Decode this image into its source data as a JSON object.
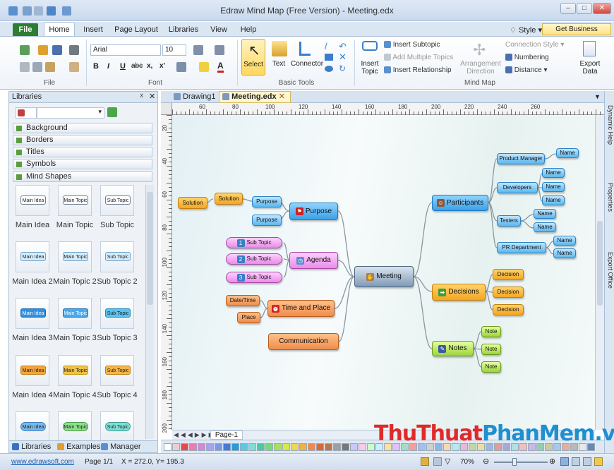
{
  "window": {
    "title": "Edraw Mind Map (Free Version) - Meeting.edx"
  },
  "ribbon": {
    "tabs": [
      "File",
      "Home",
      "Insert",
      "Page Layout",
      "Libraries",
      "View",
      "Help"
    ],
    "style_label": "Style",
    "business_label": "Get Business Version...",
    "font_name": "Arial",
    "font_size": "10",
    "group_labels": {
      "file": "File",
      "font": "Font",
      "basic_tools": "Basic Tools",
      "mind_map": "Mind Map"
    },
    "select_label": "Select",
    "text_label": "Text",
    "connector_label": "Connector",
    "insert_topic_label": "Insert\nTopic",
    "insert_subtopic_label": "Insert Subtopic",
    "add_multiple_label": "Add Multiple Topics",
    "insert_relationship_label": "Insert Relationship",
    "arrangement_label": "Arrangement\nDirection",
    "connection_style_label": "Connection Style",
    "numbering_label": "Numbering",
    "distance_label": "Distance",
    "export_label": "Export\nData"
  },
  "libraries": {
    "title": "Libraries",
    "categories": [
      "Background",
      "Borders",
      "Titles",
      "Symbols",
      "Mind Shapes"
    ],
    "shapes": [
      {
        "shape_text": "Main Idea",
        "label": "Main Idea",
        "fill": "#ffffff",
        "stroke": "#6f7f90"
      },
      {
        "shape_text": "Main Topic",
        "label": "Main Topic",
        "fill": "#ffffff",
        "stroke": "#6f7f90"
      },
      {
        "shape_text": "Sub Topic",
        "label": "Sub Topic",
        "fill": "#ffffff",
        "stroke": "#6f7f90"
      },
      {
        "shape_text": "Main Idea",
        "label": "Main Idea 2",
        "fill": "#d6eefc",
        "stroke": "#6f9fc6"
      },
      {
        "shape_text": "Main Topic",
        "label": "Main Topic 2",
        "fill": "#d6eefc",
        "stroke": "#6f9fc6"
      },
      {
        "shape_text": "Sub Topic",
        "label": "Sub Topic 2",
        "fill": "#d6eefc",
        "stroke": "#6f9fc6"
      },
      {
        "shape_text": "Main Idea",
        "label": "Main Idea 3",
        "fill": "#2f8fe0",
        "stroke": "#1f6db0"
      },
      {
        "shape_text": "Main Topic",
        "label": "Main Topic 3",
        "fill": "#4aa8ec",
        "stroke": "#1f6db0"
      },
      {
        "shape_text": "Sub Topic",
        "label": "Sub Topic 3",
        "fill": "#5ac4f0",
        "stroke": "#1f8ab0"
      },
      {
        "shape_text": "Main Idea",
        "label": "Main Idea 4",
        "fill": "#f5a43c",
        "stroke": "#c47f0e"
      },
      {
        "shape_text": "Main Topic",
        "label": "Main Topic 4",
        "fill": "#f1c24a",
        "stroke": "#c49a0e"
      },
      {
        "shape_text": "Sub Topic",
        "label": "Sub Topic 4",
        "fill": "#f5b64a",
        "stroke": "#c47f0e"
      },
      {
        "shape_text": "Main Idea",
        "label": "",
        "fill": "#7ab8ef",
        "stroke": "#3c7fc0"
      },
      {
        "shape_text": "Main Topic",
        "label": "",
        "fill": "#8ee28e",
        "stroke": "#4a9a4a"
      },
      {
        "shape_text": "Sub Topic",
        "label": "",
        "fill": "#7fe0d8",
        "stroke": "#3a9a92"
      }
    ],
    "bottom_tabs": [
      "Libraries",
      "Examples",
      "Manager"
    ]
  },
  "doc_tabs": [
    "Drawing1",
    "Meeting.edx"
  ],
  "page_tab": "Page-1",
  "side_tabs": [
    "Dynamic Help",
    "Properties",
    "Export Office"
  ],
  "mindmap": {
    "center": "Meeting",
    "purpose": "Purpose",
    "purpose_children": [
      "Purpose",
      "Purpose"
    ],
    "solutions": [
      "Solution",
      "Solution"
    ],
    "agenda": "Agenda",
    "agenda_children": [
      "Sub Topic",
      "Sub Topic",
      "Sub Topic"
    ],
    "agenda_numbers": [
      "1",
      "2",
      "3"
    ],
    "time_place": "Time and Place",
    "time_place_children": [
      "Date/Time",
      "Place"
    ],
    "communication": "Communication",
    "participants": "Participants",
    "product_manager": "Product Manager",
    "developers": "Developers",
    "testers": "Testers",
    "pr_department": "PR Department",
    "name": "Name",
    "decisions": "Decisions",
    "decision_child": "Decision",
    "notes": "Notes",
    "note_child": "Note"
  },
  "status": {
    "url": "www.edrawsoft.com",
    "page": "Page 1/1",
    "coords": "X = 272.0, Y= 195.3",
    "zoom": "70%"
  },
  "watermark": {
    "part1": "ThuThuat",
    "part2": "PhanMem",
    "part3": ".vn"
  },
  "ruler": {
    "h_ticks": [
      "60",
      "80",
      "100",
      "120",
      "140",
      "160",
      "180",
      "200",
      "220",
      "240",
      "260"
    ],
    "v_ticks": [
      "20",
      "40",
      "60",
      "80",
      "100",
      "120",
      "140",
      "160",
      "180",
      "200"
    ]
  },
  "colors": {
    "accent": "#2e7d32",
    "topic_blue": "#3aa0e8",
    "topic_orange": "#f5a623"
  }
}
